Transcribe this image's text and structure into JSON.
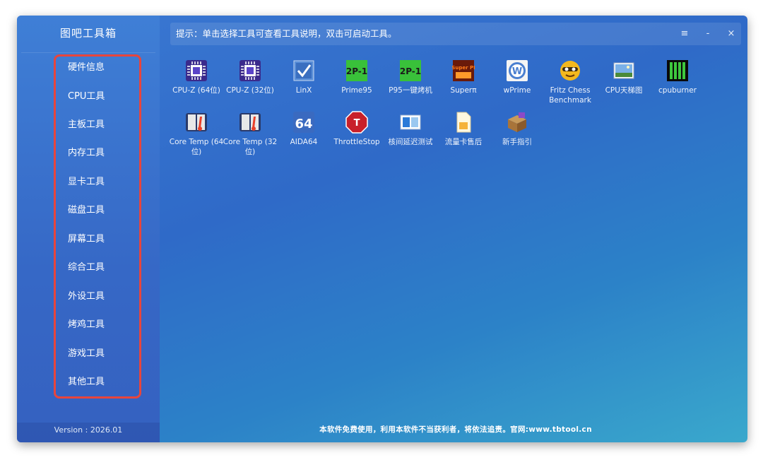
{
  "app": {
    "title": "图吧工具箱",
    "version": "Version : 2026.01"
  },
  "hint": {
    "text": "提示：单击选择工具可查看工具说明，双击可启动工具。"
  },
  "window_controls": {
    "menu": "≡",
    "minimize": "-",
    "close": "×"
  },
  "sidebar": {
    "items": [
      {
        "label": "硬件信息"
      },
      {
        "label": "CPU工具"
      },
      {
        "label": "主板工具"
      },
      {
        "label": "内存工具"
      },
      {
        "label": "显卡工具"
      },
      {
        "label": "磁盘工具"
      },
      {
        "label": "屏幕工具"
      },
      {
        "label": "综合工具"
      },
      {
        "label": "外设工具"
      },
      {
        "label": "烤鸡工具"
      },
      {
        "label": "游戏工具"
      },
      {
        "label": "其他工具"
      }
    ],
    "highlight_color": "#e8453c"
  },
  "tools": [
    {
      "label": "CPU-Z (64位)",
      "icon": "cpu-z-icon"
    },
    {
      "label": "CPU-Z (32位)",
      "icon": "cpu-z-icon"
    },
    {
      "label": "LinX",
      "icon": "linx-icon"
    },
    {
      "label": "Prime95",
      "icon": "prime95-icon"
    },
    {
      "label": "P95一键烤机",
      "icon": "prime95-icon"
    },
    {
      "label": "Superπ",
      "icon": "superpi-icon"
    },
    {
      "label": "wPrime",
      "icon": "wprime-icon"
    },
    {
      "label": "Fritz Chess Benchmark",
      "icon": "fritz-chess-icon"
    },
    {
      "label": "CPU天梯图",
      "icon": "cpu-ladder-icon"
    },
    {
      "label": "cpuburner",
      "icon": "cpuburner-icon"
    },
    {
      "label": "Core Temp (64位)",
      "icon": "core-temp-icon"
    },
    {
      "label": "Core Temp (32位)",
      "icon": "core-temp-icon"
    },
    {
      "label": "AIDA64",
      "icon": "aida64-icon"
    },
    {
      "label": "ThrottleStop",
      "icon": "throttlestop-icon"
    },
    {
      "label": "核间延迟测试",
      "icon": "core-latency-icon"
    },
    {
      "label": "流量卡售后",
      "icon": "sim-card-icon"
    },
    {
      "label": "新手指引",
      "icon": "guide-icon"
    }
  ],
  "icon_text": {
    "aida64": "64",
    "prime95": "2P-1",
    "superpi": "Super PI",
    "throttlestop": "T"
  },
  "footer": {
    "text": "本软件免费使用，利用本软件不当获利者，将依法追责。官网:www.tbtool.cn"
  }
}
